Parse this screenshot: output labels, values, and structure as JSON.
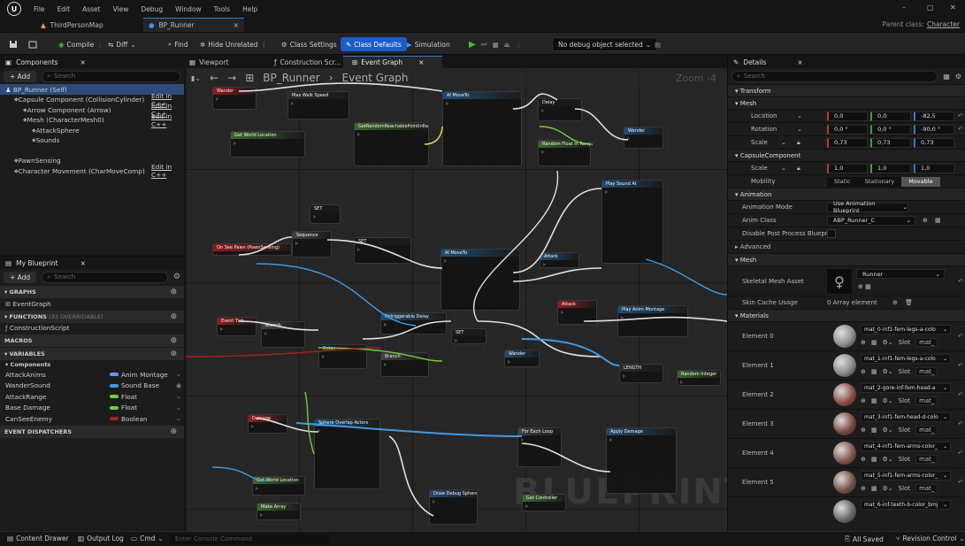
{
  "menu": [
    "File",
    "Edit",
    "Asset",
    "View",
    "Debug",
    "Window",
    "Tools",
    "Help"
  ],
  "window_controls": {
    "minimize": "–",
    "maximize": "▢",
    "close": "✕"
  },
  "tabs": {
    "map": "ThirdPersonMap",
    "blueprint": "BP_Runner",
    "close": "×"
  },
  "parent_class": {
    "label": "Parent class:",
    "value": "Character"
  },
  "toolbar": {
    "compile": "Compile",
    "diff": "Diff",
    "find": "Find",
    "hide_unrelated": "Hide Unrelated",
    "class_settings": "Class Settings",
    "class_defaults": "Class Defaults",
    "simulation": "Simulation",
    "debug_object": "No debug object selected"
  },
  "components": {
    "tab": "Components",
    "add": "+ Add",
    "search": "Search",
    "self": "BP_Runner (Self)",
    "edit_cpp": "Edit in C++",
    "items": [
      {
        "label": "Capsule Component (CollisionCylinder)",
        "indent": 1,
        "edit": true
      },
      {
        "label": "Arrow Component (Arrow)",
        "indent": 2,
        "edit": true
      },
      {
        "label": "Mesh (CharacterMesh0)",
        "indent": 2,
        "edit": true
      },
      {
        "label": "AttackSphere",
        "indent": 3,
        "edit": false
      },
      {
        "label": "Sounds",
        "indent": 3,
        "edit": false
      },
      {
        "label": "",
        "indent": 0,
        "edit": false
      },
      {
        "label": "PawnSensing",
        "indent": 1,
        "edit": false
      },
      {
        "label": "Character Movement (CharMoveComp)",
        "indent": 1,
        "edit": true
      }
    ]
  },
  "my_blueprint": {
    "tab": "My Blueprint",
    "add": "+ Add",
    "search": "Search",
    "graphs": "GRAPHS",
    "event_graph": "EventGraph",
    "functions": "FUNCTIONS",
    "functions_count": "(33 OVERRIDABLE)",
    "construction": "ConstructionScript",
    "macros": "MACROS",
    "variables": "VARIABLES",
    "components_cat": "Components",
    "vars": [
      {
        "name": "AttackAnims",
        "type": "Anim Montage",
        "color": "#4aa3ff"
      },
      {
        "name": "WanderSound",
        "type": "Sound Base",
        "color": "#3d9be9"
      },
      {
        "name": "AttackRange",
        "type": "Float",
        "color": "#6ccf3f"
      },
      {
        "name": "Base Damage",
        "type": "Float",
        "color": "#6ccf3f"
      },
      {
        "name": "CanSeeEnemy",
        "type": "Boolean",
        "color": "#a81f1f"
      }
    ],
    "dispatchers": "EVENT DISPATCHERS"
  },
  "graph": {
    "tab_viewport": "Viewport",
    "tab_construction": "Construction Scr...",
    "tab_event": "Event Graph",
    "path": "BP_Runner",
    "section": "Event Graph",
    "zoom": "Zoom -4",
    "watermark": "BLUEPRINT"
  },
  "details": {
    "tab": "Details",
    "search": "Search",
    "transform": "Transform",
    "mesh": "Mesh",
    "location": "Location",
    "rotation": "Rotation",
    "scale": "Scale",
    "loc": [
      "0,0",
      "0,0",
      "-82,5"
    ],
    "rot": [
      "0,0 °",
      "0,0 °",
      "-90,0 °"
    ],
    "scl": [
      "0,73",
      "0,73",
      "0,73"
    ],
    "capsule": "CapsuleComponent",
    "cap_scl": [
      "1,0",
      "1,0",
      "1,0"
    ],
    "mobility": "Mobility",
    "mob_opts": [
      "Static",
      "Stationary",
      "Movable"
    ],
    "animation": "Animation",
    "anim_mode": "Animation Mode",
    "anim_mode_val": "Use Animation Blueprint",
    "anim_class": "Anim Class",
    "anim_class_val": "ABP_Runner_C",
    "disable_pp": "Disable Post Process Blueprint",
    "advanced": "Advanced",
    "mesh2": "Mesh",
    "skel": "Skeletal Mesh Asset",
    "skel_val": "Runner",
    "skin": "Skin Cache Usage",
    "skin_val": "0 Array element",
    "materials": "Materials",
    "slot": "Slot",
    "mats": [
      {
        "el": "Element 0",
        "val": "mat_0-inf1-fem-legs-a-colo",
        "slot": "mat_",
        "ball": "#8f8f8f"
      },
      {
        "el": "Element 1",
        "val": "mat_1-inf1-fem-legs-a-colo",
        "slot": "mat_",
        "ball": "#8a8a8a"
      },
      {
        "el": "Element 2",
        "val": "mat_2-gore-inf-fem-head-a",
        "slot": "mat_",
        "ball": "#8c5046"
      },
      {
        "el": "Element 3",
        "val": "mat_3-inf1-fem-head-d-colo",
        "slot": "mat_",
        "ball": "#7d4a40"
      },
      {
        "el": "Element 4",
        "val": "mat_4-inf1-fem-arms-color_",
        "slot": "mat_",
        "ball": "#84584a"
      },
      {
        "el": "Element 5",
        "val": "mat_5-inf1-fem-arms-color_",
        "slot": "mat_",
        "ball": "#7a5248"
      },
      {
        "el": "",
        "val": "mat_6-inf-teeth-b-color_bmj",
        "slot": "",
        "ball": "#6a6a6a"
      }
    ]
  },
  "status": {
    "content_drawer": "Content Drawer",
    "output_log": "Output Log",
    "cmd": "Cmd",
    "console": "Enter Console Command",
    "saved": "All Saved",
    "revision": "Revision Control"
  },
  "graph_nodes": [
    {
      "title": "Wander",
      "color": "#9b1b1b"
    },
    {
      "title": "Max Walk Speed",
      "color": "#2a2a2a"
    },
    {
      "title": "AI MoveTo",
      "color": "#1f4f7a"
    },
    {
      "title": "Delay",
      "color": "#1a1a1a"
    },
    {
      "title": "Get World Location",
      "color": "#3d6b2a"
    },
    {
      "title": "GetRandomReachablePointInRadius",
      "color": "#3d6b2a"
    },
    {
      "title": "Random Float In Range",
      "color": "#3d6b2a"
    },
    {
      "title": "Wander",
      "color": "#1f4f7a"
    },
    {
      "title": "SET",
      "color": "#1a1a1a"
    },
    {
      "title": "Play Sound At",
      "color": "#1f4f7a"
    },
    {
      "title": "Sequence",
      "color": "#444"
    },
    {
      "title": "SET",
      "color": "#1a1a1a"
    },
    {
      "title": "On See Pawn (PawnSensing)",
      "color": "#9b1b1b"
    },
    {
      "title": "AI MoveTo",
      "color": "#1f4f7a"
    },
    {
      "title": "Attack",
      "color": "#1f4f7a"
    },
    {
      "title": "Retriggerable Delay",
      "color": "#1f4f7a"
    },
    {
      "title": "Event Tick",
      "color": "#9b1b1b"
    },
    {
      "title": "Branch",
      "color": "#444"
    },
    {
      "title": "Delay",
      "color": "#1a1a1a"
    },
    {
      "title": "Branch",
      "color": "#444"
    },
    {
      "title": "SET",
      "color": "#1a1a1a"
    },
    {
      "title": "Wander",
      "color": "#1f4f7a"
    },
    {
      "title": "Attack",
      "color": "#9b1b1b"
    },
    {
      "title": "Play Anim Montage",
      "color": "#1f4f7a"
    },
    {
      "title": "Random Integer",
      "color": "#3d6b2a"
    },
    {
      "title": "Damage",
      "color": "#9b1b1b"
    },
    {
      "title": "Sphere Overlap Actors",
      "color": "#1f4f7a"
    },
    {
      "title": "For Each Loop",
      "color": "#444"
    },
    {
      "title": "Apply Damage",
      "color": "#1f4f7a"
    },
    {
      "title": "Get World Location",
      "color": "#3d6b2a"
    },
    {
      "title": "Make Array",
      "color": "#3d6b2a"
    },
    {
      "title": "Draw Debug Sphere",
      "color": "#1f4f7a"
    },
    {
      "title": "Get Controller",
      "color": "#3d6b2a"
    },
    {
      "title": "LENGTH",
      "color": "#2a2a2a"
    }
  ]
}
